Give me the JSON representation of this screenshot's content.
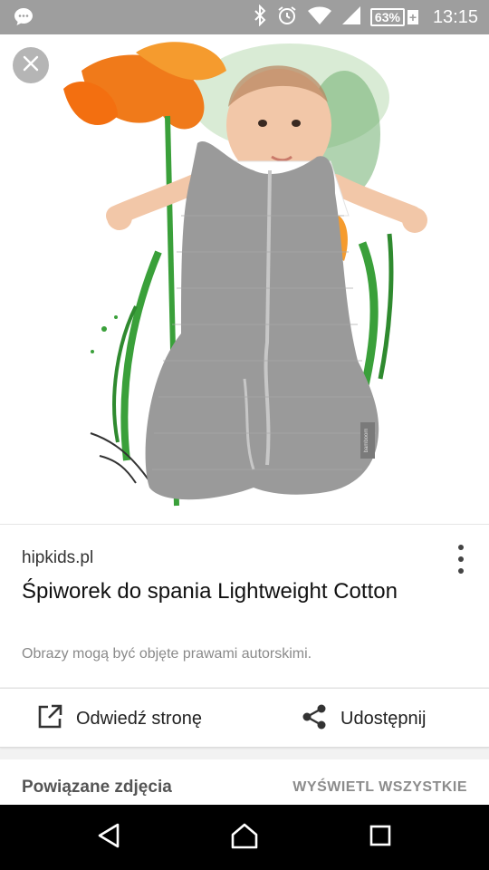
{
  "status_bar": {
    "battery_percent": "63%",
    "battery_plus": "+",
    "time": "13:15"
  },
  "image": {
    "brand_tag": "bamboom"
  },
  "result": {
    "source": "hipkids.pl",
    "title": "Śpiworek do spania Lightweight Cotton",
    "copyright_note": "Obrazy mogą być objęte prawami autorskimi."
  },
  "actions": {
    "visit_label": "Odwiedź stronę",
    "share_label": "Udostępnij"
  },
  "related": {
    "title": "Powiązane zdjęcia",
    "view_all": "WYŚWIETL WSZYSTKIE"
  },
  "icons": {
    "chat": "chat-bubble-icon",
    "bluetooth": "bluetooth-icon",
    "alarm": "alarm-icon",
    "wifi": "wifi-icon",
    "signal": "signal-icon",
    "close": "close-icon",
    "more": "more-vert-icon",
    "open_external": "open-in-new-icon",
    "share": "share-icon",
    "back": "back-icon",
    "home": "home-icon",
    "recents": "recents-icon"
  },
  "colors": {
    "status_bar": "#9e9e9e",
    "nav_bar": "#000000",
    "flower_orange": "#f07a1a",
    "leaf_green": "#3aa03a",
    "garment_gray": "#9a9a9a"
  }
}
